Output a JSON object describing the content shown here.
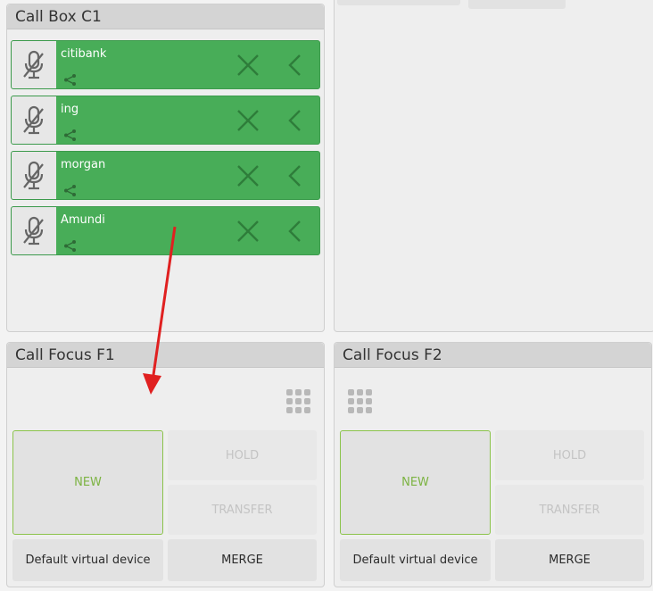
{
  "call_box": {
    "title": "Call Box C1",
    "items": [
      {
        "name": "citibank"
      },
      {
        "name": "ing"
      },
      {
        "name": "morgan"
      },
      {
        "name": "Amundi"
      }
    ]
  },
  "focus_f1": {
    "title": "Call Focus F1",
    "new_label": "NEW",
    "hold_label": "HOLD",
    "transfer_label": "TRANSFER",
    "device_label": "Default virtual device",
    "merge_label": "MERGE"
  },
  "focus_f2": {
    "title": "Call Focus F2",
    "new_label": "NEW",
    "hold_label": "HOLD",
    "transfer_label": "TRANSFER",
    "device_label": "Default virtual device",
    "merge_label": "MERGE"
  },
  "colors": {
    "active_call": "#48ad58",
    "new_accent": "#7cb342",
    "annotation_arrow": "#e02020"
  },
  "icons": [
    "microphone-muted-icon",
    "route-icon",
    "close-icon",
    "chevron-left-icon",
    "keypad-icon"
  ]
}
